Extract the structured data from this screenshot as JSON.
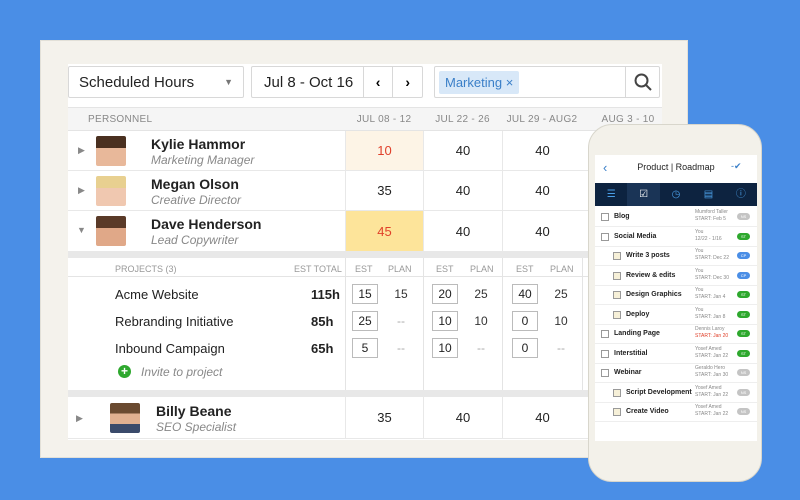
{
  "toolbar": {
    "view_select": "Scheduled Hours",
    "date_range": "Jul 8 - Oct 16",
    "filter_tag": "Marketing"
  },
  "table": {
    "personnel_header": "PERSONNEL",
    "weeks": [
      "JUL 08 - 12",
      "JUL 22 - 26",
      "JUL 29 - AUG2",
      "AUG 3 - 10"
    ],
    "people": [
      {
        "name": "Kylie Hammor",
        "role": "Marketing Manager",
        "hours": [
          "10",
          "40",
          "40"
        ],
        "highlight": "#fdf4e6",
        "highlight_text": "#e0402a"
      },
      {
        "name": "Megan Olson",
        "role": "Creative Director",
        "hours": [
          "35",
          "40",
          "40"
        ]
      },
      {
        "name": "Dave Henderson",
        "role": "Lead Copywriter",
        "hours": [
          "45",
          "40",
          "40"
        ],
        "highlight": "#fde49a",
        "highlight_text": "#e0402a",
        "expanded": true
      },
      {
        "name": "Billy Beane",
        "role": "SEO Specialist",
        "hours": [
          "35",
          "40",
          "40"
        ]
      }
    ],
    "projects": {
      "header": "PROJECTS (3)",
      "est_total": "EST TOTAL",
      "est": "EST",
      "plan": "PLAN",
      "items": [
        {
          "name": "Acme Website",
          "total": "115h",
          "weeks": [
            [
              "15",
              "15"
            ],
            [
              "20",
              "25"
            ],
            [
              "40",
              "25"
            ]
          ]
        },
        {
          "name": "Rebranding Initiative",
          "total": "85h",
          "weeks": [
            [
              "25",
              "--"
            ],
            [
              "10",
              "10"
            ],
            [
              "0",
              "10"
            ]
          ]
        },
        {
          "name": "Inbound Campaign",
          "total": "65h",
          "weeks": [
            [
              "5",
              "--"
            ],
            [
              "10",
              "--"
            ],
            [
              "0",
              "--"
            ]
          ]
        }
      ],
      "invite": "Invite to project"
    }
  },
  "phone": {
    "title": "Product | Roadmap",
    "items": [
      {
        "label": "Blog",
        "who": "Mumford Taller",
        "date": "START: Feb 5",
        "status": "NS",
        "level": 0
      },
      {
        "label": "Social Media",
        "who": "You",
        "date": "12/22 - 1/16",
        "status": "ST",
        "level": 0
      },
      {
        "label": "Write 3 posts",
        "who": "You",
        "date": "START: Dec 22",
        "status": "CP",
        "level": 1
      },
      {
        "label": "Review & edits",
        "who": "You",
        "date": "START: Dec 30",
        "status": "CP",
        "level": 1
      },
      {
        "label": "Design Graphics",
        "who": "You",
        "date": "START: Jan 4",
        "status": "ST",
        "level": 1
      },
      {
        "label": "Deploy",
        "who": "You",
        "date": "START: Jan 8",
        "status": "ST",
        "level": 1
      },
      {
        "label": "Landing Page",
        "who": "Dennis Laroy",
        "date": "START: Jan 20",
        "status": "ST",
        "level": 0,
        "late": true
      },
      {
        "label": "Interstitial",
        "who": "Yosef Amed",
        "date": "START: Jan 22",
        "status": "ST",
        "level": 0
      },
      {
        "label": "Webinar",
        "who": "Geraldo Hero",
        "date": "START: Jan 30",
        "status": "NS",
        "level": 0
      },
      {
        "label": "Script Development",
        "who": "Yosef Amed",
        "date": "START: Jan 22",
        "status": "NS",
        "level": 1
      },
      {
        "label": "Create Video",
        "who": "Yosef Amed",
        "date": "START: Jan 22",
        "status": "NS",
        "level": 1
      }
    ],
    "status_colors": {
      "NS": "#c4c4c4",
      "ST": "#2ea82e",
      "CP": "#4a8ee6"
    }
  },
  "colors": {
    "background": "#4a8ee6",
    "tag": "#d8e8f8",
    "tag_text": "#3a7fc8",
    "phone_nav": "#0d2340"
  }
}
